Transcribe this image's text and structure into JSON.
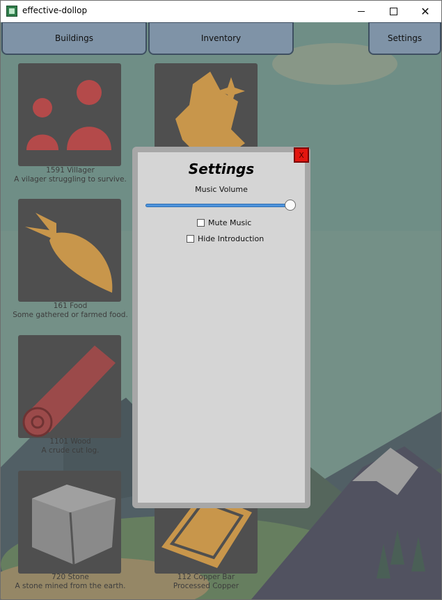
{
  "window": {
    "title": "effective-dollop",
    "controls": {
      "minimize": "minimize",
      "maximize": "maximize",
      "close": "close"
    }
  },
  "tabs": [
    {
      "label": "Buildings"
    },
    {
      "label": "Inventory"
    },
    {
      "label": "Settings"
    }
  ],
  "resources": [
    {
      "count_label": "1591 Villager",
      "description": "A vilager struggling to survive.",
      "icon": "villager-icon",
      "color": "#b44a4a"
    },
    {
      "count_label": "161 Food",
      "description": "Some gathered or farmed food.",
      "icon": "carrot-icon",
      "color": "#c8964b"
    },
    {
      "count_label": "1101 Wood",
      "description": "A crude cut log.",
      "icon": "log-icon",
      "color": "#9b4a4a"
    },
    {
      "count_label": "720 Stone",
      "description": "A stone mined from the earth.",
      "icon": "stone-icon",
      "color": "#8a8a8a"
    },
    {
      "count_label": "",
      "description": "",
      "icon": "ore-icon",
      "color": "#c8964b"
    },
    {
      "count_label": "112 Copper Bar",
      "description": "Processed Copper",
      "icon": "copper-bar-icon",
      "color": "#c8964b"
    }
  ],
  "settings_dialog": {
    "title": "Settings",
    "close_label": "X",
    "music_volume_label": "Music Volume",
    "music_volume_value": 1.0,
    "mute_music_label": "Mute Music",
    "mute_music_checked": false,
    "hide_intro_label": "Hide Introduction",
    "hide_intro_checked": false
  },
  "colors": {
    "accent": "#4d93dc",
    "tab_bg": "#7f93a7",
    "close_button": "#e3150f"
  }
}
